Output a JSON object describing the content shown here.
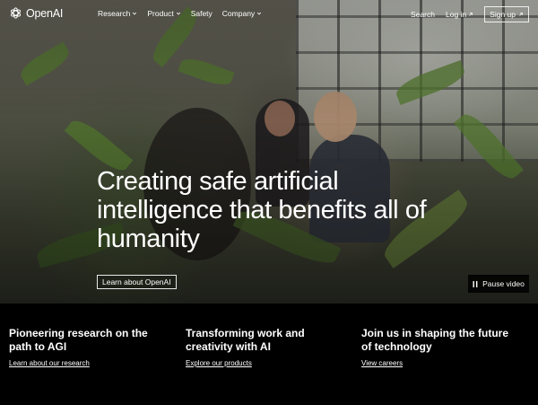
{
  "brand": {
    "name": "OpenAI"
  },
  "nav": {
    "items": [
      {
        "label": "Research",
        "has_menu": true
      },
      {
        "label": "Product",
        "has_menu": true
      },
      {
        "label": "Safety",
        "has_menu": false
      },
      {
        "label": "Company",
        "has_menu": true
      }
    ],
    "search_label": "Search",
    "login_label": "Log in",
    "signup_label": "Sign up"
  },
  "hero": {
    "headline": "Creating safe artificial intelligence that benefits all of humanity",
    "cta_label": "Learn about OpenAI",
    "pause_label": "Pause video"
  },
  "cards": [
    {
      "title": "Pioneering research on the path to AGI",
      "link": "Learn about our research"
    },
    {
      "title": "Transforming work and creativity with AI",
      "link": "Explore our products"
    },
    {
      "title": "Join us in shaping the future of technology",
      "link": "View careers"
    }
  ],
  "colors": {
    "background": "#000000",
    "text": "#ffffff"
  },
  "icons": {
    "logo": "openai-logo-icon",
    "menu": "chevron-down-icon",
    "external": "arrow-up-right-icon",
    "pause": "pause-icon"
  }
}
